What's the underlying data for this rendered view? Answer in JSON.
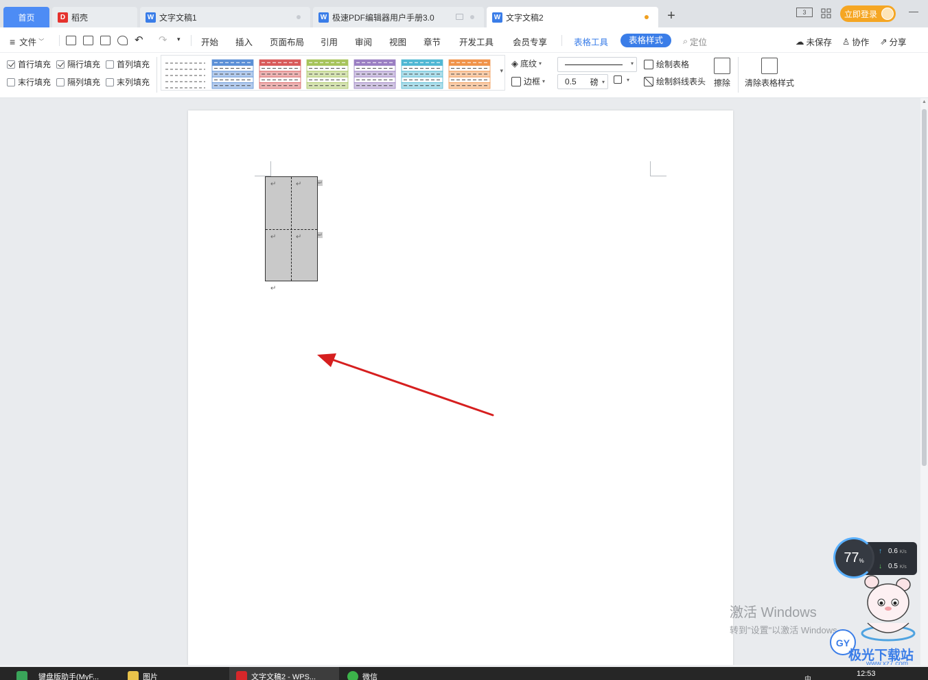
{
  "tabs": [
    {
      "label": "首页"
    },
    {
      "label": "稻壳"
    },
    {
      "label": "文字文稿1"
    },
    {
      "label": "极速PDF编辑器用户手册3.0"
    },
    {
      "label": "文字文稿2"
    }
  ],
  "titlebar": {
    "login_label": "立即登录",
    "plus": "+",
    "minimize": "—"
  },
  "menu": {
    "file": "文件",
    "items": [
      "开始",
      "插入",
      "页面布局",
      "引用",
      "审阅",
      "视图",
      "章节",
      "开发工具",
      "会员专享"
    ],
    "table_tools": "表格工具",
    "table_style": "表格样式",
    "locate": "定位",
    "unsaved": "未保存",
    "collab": "协作",
    "share": "分享"
  },
  "ribbon": {
    "fill_options": [
      {
        "label": "首行填充",
        "checked": true
      },
      {
        "label": "隔行填充",
        "checked": true
      },
      {
        "label": "首列填充",
        "checked": false
      },
      {
        "label": "末行填充",
        "checked": false
      },
      {
        "label": "隔列填充",
        "checked": false
      },
      {
        "label": "末列填充",
        "checked": false
      }
    ],
    "style_colors": [
      "#5b8fd6",
      "#d85a5a",
      "#a6c35a",
      "#9a7ec2",
      "#4fb7d3",
      "#f0934a"
    ],
    "shading": "底纹",
    "border": "边框",
    "line_width": "0.5",
    "line_unit": "磅",
    "draw_table": "绘制表格",
    "draw_diagonal": "绘制斜线表头",
    "erase": "擦除",
    "clear_style": "清除表格样式"
  },
  "document": {
    "para_mark": "↵"
  },
  "watermark": {
    "line1": "激活 Windows",
    "line2": "转到\"设置\"以激活 Windows。"
  },
  "speed": {
    "percent": "77",
    "percent_unit": "%",
    "up": "0.6",
    "down": "0.5",
    "unit": "K/s"
  },
  "mascot": {
    "brand": "极光下载站",
    "url": "www.xz7.com",
    "badge": "GY"
  },
  "taskbar": {
    "items": [
      "键盘版助手(MyF...",
      "图片",
      "文字文稿2 - WPS...",
      "微信"
    ],
    "clock": "12:53",
    "ime": "中"
  }
}
